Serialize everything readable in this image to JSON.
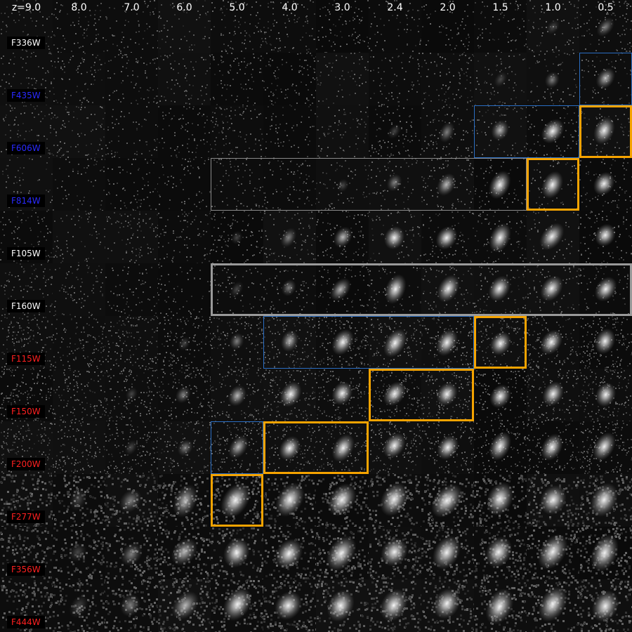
{
  "redshifts": [
    "z=9.0",
    "8.0",
    "7.0",
    "6.0",
    "5.0",
    "4.0",
    "3.0",
    "2.4",
    "2.0",
    "1.5",
    "1.0",
    "0.5"
  ],
  "filters": [
    {
      "name": "F336W",
      "color": "#ffffff"
    },
    {
      "name": "F435W",
      "color": "#2a2aff"
    },
    {
      "name": "F606W",
      "color": "#2a2aff"
    },
    {
      "name": "F814W",
      "color": "#2a2aff"
    },
    {
      "name": "F105W",
      "color": "#ffffff"
    },
    {
      "name": "F160W",
      "color": "#ffffff"
    },
    {
      "name": "F115W",
      "color": "#ff2020"
    },
    {
      "name": "F150W",
      "color": "#ff2020"
    },
    {
      "name": "F200W",
      "color": "#ff2020"
    },
    {
      "name": "F277W",
      "color": "#ff2020"
    },
    {
      "name": "F356W",
      "color": "#ff2020"
    },
    {
      "name": "F444W",
      "color": "#ff2020"
    }
  ],
  "highlight_colors": {
    "grey": "#8a8a8a",
    "blue": "#2a6ec4",
    "orange": "#f5a300"
  }
}
